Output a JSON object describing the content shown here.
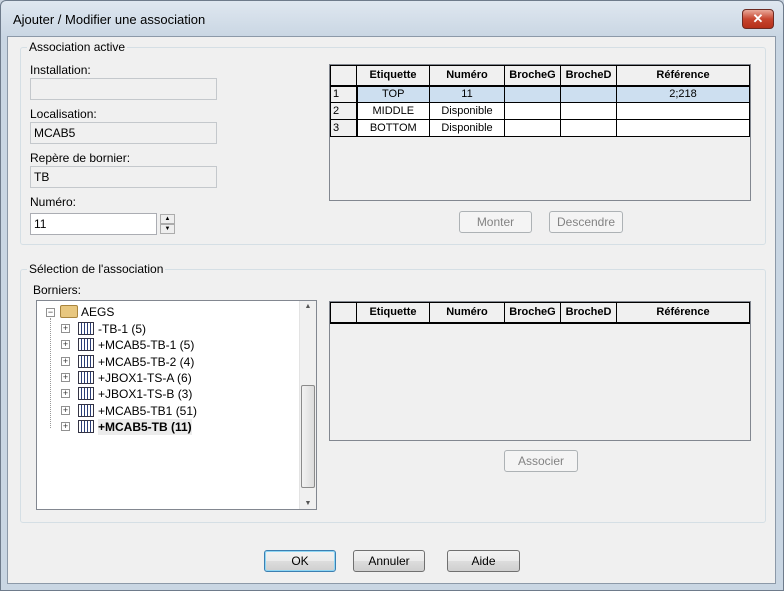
{
  "window": {
    "title": "Ajouter / Modifier une association",
    "close": "✕"
  },
  "active": {
    "group_label": "Association active",
    "installation_label": "Installation:",
    "installation_value": "",
    "localisation_label": "Localisation:",
    "localisation_value": "MCAB5",
    "repere_label": "Repère de bornier:",
    "repere_value": "TB",
    "numero_label": "Numéro:",
    "numero_value": "11",
    "columns": [
      "Etiquette",
      "Numéro",
      "BrocheG",
      "BrocheD",
      "Référence"
    ],
    "rows": [
      {
        "n": "1",
        "etiquette": "TOP",
        "numero": "11",
        "brocheg": "",
        "brocheD": "",
        "reference": "2;218"
      },
      {
        "n": "2",
        "etiquette": "MIDDLE",
        "numero": "Disponible",
        "brocheg": "",
        "brocheD": "",
        "reference": ""
      },
      {
        "n": "3",
        "etiquette": "BOTTOM",
        "numero": "Disponible",
        "brocheg": "",
        "brocheD": "",
        "reference": ""
      }
    ],
    "monter": "Monter",
    "descendre": "Descendre"
  },
  "selection": {
    "group_label": "Sélection de l'association",
    "borniers_label": "Borniers:",
    "root": "AEGS",
    "items": [
      "-TB-1 (5)",
      "+MCAB5-TB-1 (5)",
      "+MCAB5-TB-2 (4)",
      "+JBOX1-TS-A (6)",
      "+JBOX1-TS-B (3)",
      "+MCAB5-TB1 (51)",
      "+MCAB5-TB (11)"
    ],
    "columns": [
      "Etiquette",
      "Numéro",
      "BrocheG",
      "BrocheD",
      "Référence"
    ],
    "associer": "Associer"
  },
  "footer": {
    "ok": "OK",
    "annuler": "Annuler",
    "aide": "Aide"
  }
}
